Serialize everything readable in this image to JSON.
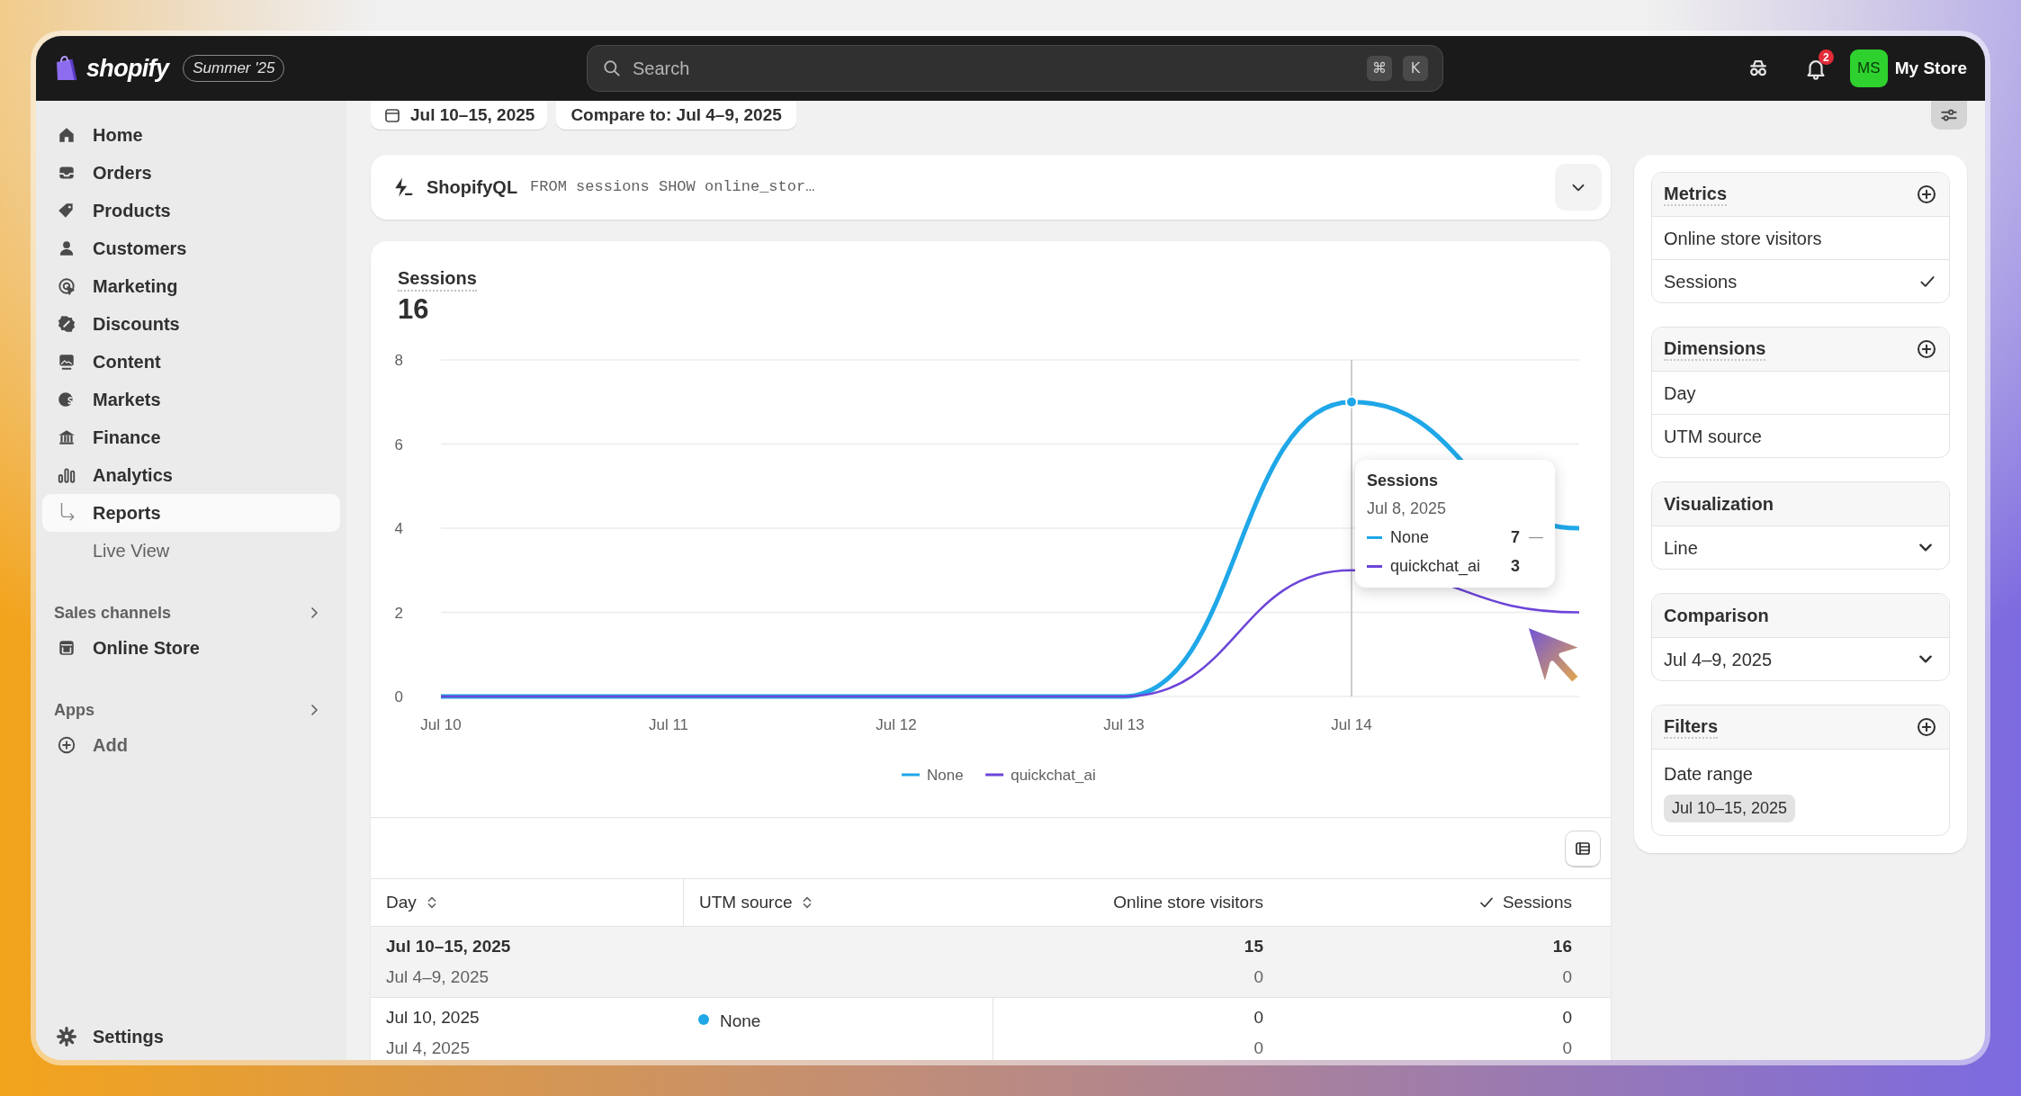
{
  "top_bar": {
    "logo": "shopify",
    "edition_badge": "Summer '25",
    "search": {
      "placeholder": "Search",
      "shortcut": [
        "⌘",
        "K"
      ]
    },
    "notification_count": "2",
    "avatar_initials": "MS",
    "store_name": "My Store"
  },
  "sidebar": {
    "items": [
      {
        "label": "Home",
        "selected": false
      },
      {
        "label": "Orders",
        "selected": false
      },
      {
        "label": "Products",
        "selected": false
      },
      {
        "label": "Customers",
        "selected": false
      },
      {
        "label": "Marketing",
        "selected": false
      },
      {
        "label": "Discounts",
        "selected": false
      },
      {
        "label": "Content",
        "selected": false
      },
      {
        "label": "Markets",
        "selected": false
      },
      {
        "label": "Finance",
        "selected": false
      },
      {
        "label": "Analytics",
        "selected": false,
        "children": [
          {
            "label": "Reports",
            "selected": true
          },
          {
            "label": "Live View",
            "selected": false
          }
        ]
      }
    ],
    "sections": [
      {
        "title": "Sales channels",
        "items": [
          {
            "label": "Online Store"
          }
        ]
      },
      {
        "title": "Apps",
        "items": [
          {
            "label": "Add"
          }
        ]
      }
    ],
    "footer": {
      "label": "Settings"
    }
  },
  "toolbar": {
    "date_range": "Jul 10–15, 2025",
    "compare": "Compare to: Jul 4–9, 2025"
  },
  "query_bar": {
    "label": "ShopifyQL",
    "query": "FROM sessions SHOW online_stor…"
  },
  "report": {
    "metric_title": "Sessions",
    "total": "16",
    "chart_data": {
      "type": "line",
      "categories": [
        "Jul 10",
        "Jul 11",
        "Jul 12",
        "Jul 13",
        "Jul 14",
        null
      ],
      "ylim": [
        0,
        8
      ],
      "yticks": [
        {
          "value": 0,
          "label": "0"
        },
        {
          "value": 2,
          "label": "2"
        },
        {
          "value": 4,
          "label": "4"
        },
        {
          "value": 6,
          "label": "6"
        },
        {
          "value": 8,
          "label": "8"
        }
      ],
      "series": [
        {
          "name": "None",
          "color": "#1fa7e8",
          "values": [
            0,
            0,
            0,
            0,
            7,
            4
          ]
        },
        {
          "name": "quickchat_ai",
          "color": "#6c45d8",
          "values": [
            0,
            0,
            0,
            0,
            3,
            2
          ]
        }
      ],
      "grid": true,
      "legend": true,
      "ref_lines": [
        {
          "axis": "x",
          "value": "Jul 14"
        }
      ]
    },
    "tooltip": {
      "title": "Sessions",
      "date": "Jul 8, 2025",
      "rows": [
        {
          "name": "None",
          "value": "7",
          "compare": "—",
          "color": "#1fa7e8"
        },
        {
          "name": "quickchat_ai",
          "value": "3",
          "color": "#6c45d8"
        }
      ]
    },
    "table": {
      "columns": [
        {
          "label": "Day",
          "sortable": true,
          "checked": false
        },
        {
          "label": "UTM source",
          "sortable": true,
          "checked": false
        },
        {
          "label": "Online store visitors",
          "sortable": false,
          "checked": false
        },
        {
          "label": "Sessions",
          "sortable": false,
          "checked": true
        }
      ],
      "rows": [
        {
          "kind": "total",
          "day": "Jul 10–15, 2025",
          "compare_day": "Jul 4–9, 2025",
          "visitors": "15",
          "compare_visitors": "0",
          "sessions": "16",
          "compare_sessions": "0"
        },
        {
          "kind": "row",
          "day": "Jul 10, 2025",
          "compare_day": "Jul 4, 2025",
          "source": "None",
          "color": "#1fa7e8",
          "visitors": "0",
          "compare_visitors": "0",
          "sessions": "0",
          "compare_sessions": "0"
        }
      ]
    }
  },
  "settings_panel": {
    "sections": [
      {
        "kind": "list",
        "title": "Metrics",
        "addable": true,
        "items": [
          {
            "label": "Online store visitors",
            "checked": false
          },
          {
            "label": "Sessions",
            "checked": true
          }
        ]
      },
      {
        "kind": "list",
        "title": "Dimensions",
        "addable": true,
        "items": [
          {
            "label": "Day",
            "checked": false
          },
          {
            "label": "UTM source",
            "checked": false
          }
        ]
      },
      {
        "kind": "select",
        "title": "Visualization",
        "addable": false,
        "value": "Line"
      },
      {
        "kind": "select",
        "title": "Comparison",
        "addable": false,
        "value": "Jul 4–9, 2025"
      },
      {
        "kind": "filter",
        "title": "Filters",
        "addable": true,
        "filters": [
          {
            "label": "Date range",
            "value": "Jul 10–15, 2025"
          }
        ]
      }
    ]
  }
}
